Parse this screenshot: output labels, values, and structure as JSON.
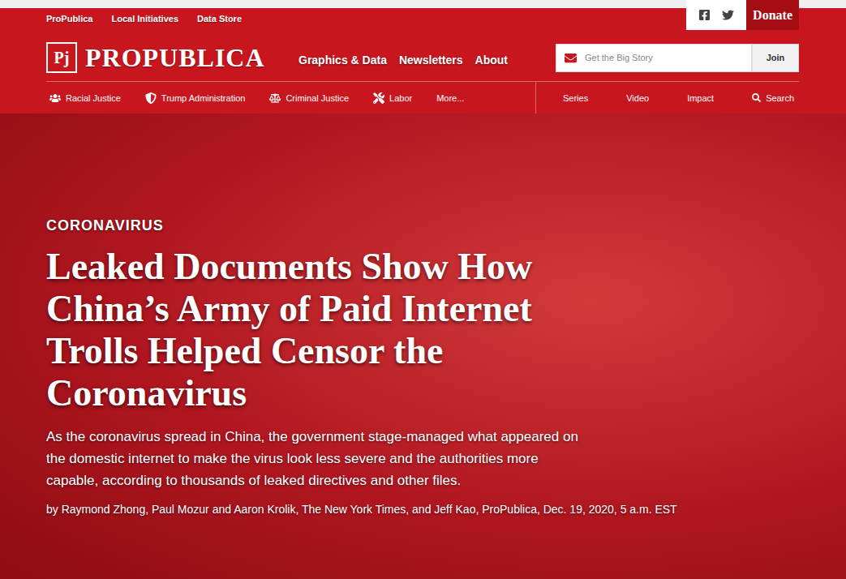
{
  "top_links": [
    "ProPublica",
    "Local Initiatives",
    "Data Store"
  ],
  "donate": "Donate",
  "logo": {
    "mark": "Pj",
    "wordmark": "PROPUBLICA"
  },
  "nav": [
    "Graphics & Data",
    "Newsletters",
    "About"
  ],
  "newsletter": {
    "placeholder": "Get the Big Story",
    "button": "Join"
  },
  "topics": [
    "Racial Justice",
    "Trump Administration",
    "Criminal Justice",
    "Labor",
    "More..."
  ],
  "sections": [
    "Series",
    "Video",
    "Impact"
  ],
  "search": "Search",
  "article": {
    "kicker": "CORONAVIRUS",
    "headline": "Leaked Documents Show How China’s Army of Paid Internet Trolls Helped Censor the Coronavirus",
    "deck": "As the coronavirus spread in China, the government stage-managed what appeared on the domestic internet to make the virus look less severe and the authorities more capable, according to thousands of leaked directives and other files.",
    "byline": "by Raymond Zhong, Paul Mozur and Aaron Krolik, The New York Times, and Jeff Kao, ProPublica, Dec. 19, 2020, 5 a.m. EST"
  }
}
